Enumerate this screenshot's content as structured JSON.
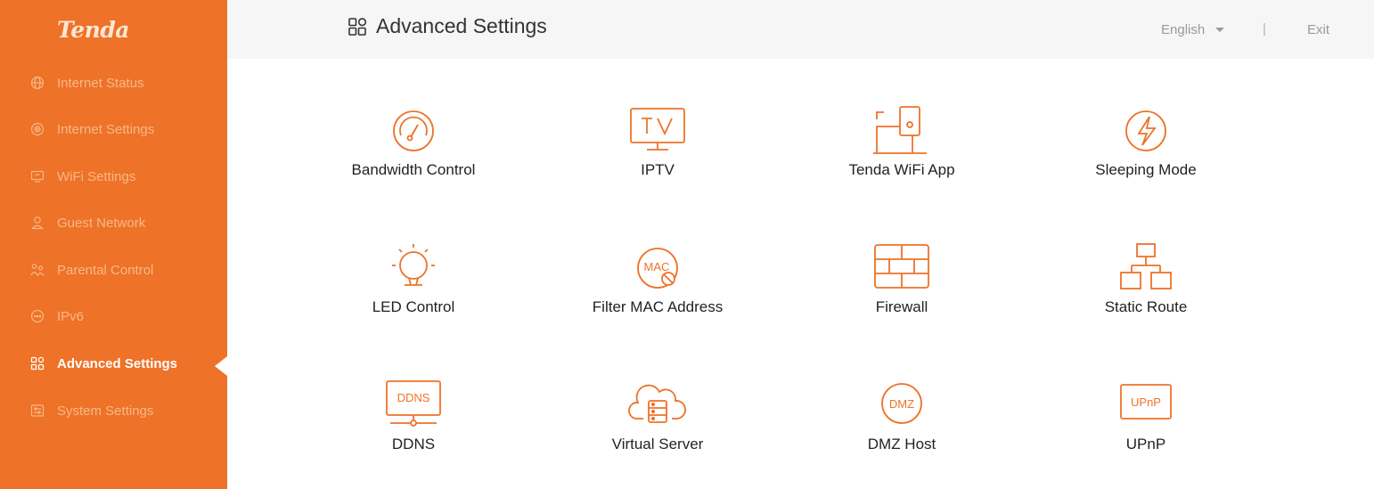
{
  "brand": {
    "logo": "Tenda"
  },
  "colors": {
    "accent": "#ee7228",
    "nav_text": "#f7b987",
    "icon": "#ee7228"
  },
  "sidebar": {
    "items": [
      {
        "label": "Internet Status",
        "icon": "globe-icon"
      },
      {
        "label": "Internet Settings",
        "icon": "internet-settings-icon"
      },
      {
        "label": "WiFi Settings",
        "icon": "wifi-settings-icon"
      },
      {
        "label": "Guest Network",
        "icon": "guest-icon"
      },
      {
        "label": "Parental Control",
        "icon": "parental-icon"
      },
      {
        "label": "IPv6",
        "icon": "ipv6-icon"
      },
      {
        "label": "Advanced Settings",
        "icon": "advanced-icon",
        "active": true
      },
      {
        "label": "System Settings",
        "icon": "system-icon"
      }
    ]
  },
  "header": {
    "title": "Advanced Settings",
    "language": "English",
    "separator": "|",
    "exit": "Exit"
  },
  "features": [
    {
      "label": "Bandwidth Control",
      "icon": "speedometer-icon"
    },
    {
      "label": "IPTV",
      "icon": "tv-icon"
    },
    {
      "label": "Tenda WiFi App",
      "icon": "wifi-app-icon"
    },
    {
      "label": "Sleeping Mode",
      "icon": "lightning-icon"
    },
    {
      "label": "LED Control",
      "icon": "bulb-icon"
    },
    {
      "label": "Filter MAC Address",
      "icon": "mac-filter-icon",
      "icon_text": "MAC"
    },
    {
      "label": "Firewall",
      "icon": "firewall-icon"
    },
    {
      "label": "Static Route",
      "icon": "network-tree-icon"
    },
    {
      "label": "DDNS",
      "icon": "ddns-icon",
      "icon_text": "DDNS"
    },
    {
      "label": "Virtual Server",
      "icon": "cloud-server-icon"
    },
    {
      "label": "DMZ Host",
      "icon": "dmz-icon",
      "icon_text": "DMZ"
    },
    {
      "label": "UPnP",
      "icon": "upnp-icon",
      "icon_text": "UPnP"
    }
  ]
}
